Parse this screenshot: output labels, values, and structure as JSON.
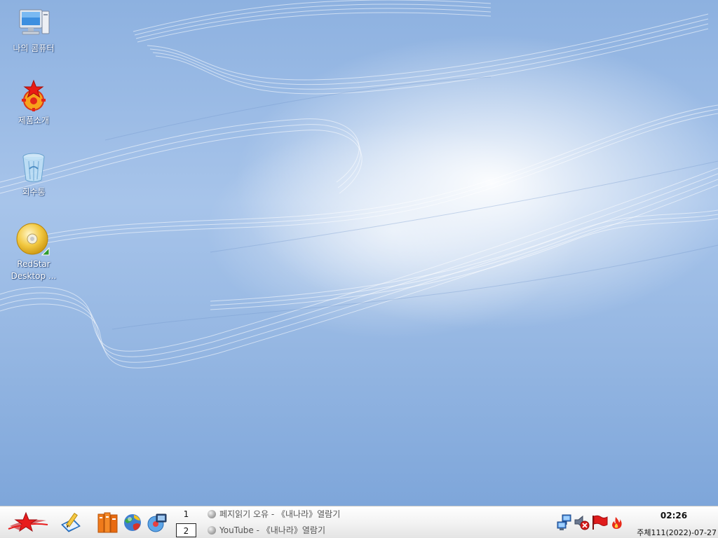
{
  "desktop": {
    "icons": [
      {
        "label": "나의 콤퓨터",
        "icon": "computer-icon"
      },
      {
        "label": "제품소개",
        "icon": "red-star-product-icon"
      },
      {
        "label": "회수통",
        "icon": "recycle-bin-icon"
      },
      {
        "label": "RedStar Desktop ...",
        "icon": "cd-disc-icon"
      }
    ]
  },
  "taskbar": {
    "start_icon": "red-star-start-icon",
    "launchers": [
      "notepad-pencil-icon",
      "books-icon",
      "globe-browser-icon",
      "media-player-icon"
    ],
    "pager": [
      "1",
      "2"
    ],
    "active_workspace": "2",
    "tasks": [
      {
        "label": "페지읽기 오유 - 《내나라》열람기"
      },
      {
        "label": "YouTube - 《내나라》열람기"
      }
    ],
    "tray": [
      "network-icon",
      "speaker-muted-icon",
      "red-flag-icon",
      "red-fire-icon"
    ],
    "clock": {
      "time": "02:26",
      "date": "주체111(2022)-07-27"
    }
  },
  "colors": {
    "accent_red": "#e01c1c",
    "taskbar_bg": "#f0f0f0",
    "desktop_blue": "#9dbde6"
  }
}
